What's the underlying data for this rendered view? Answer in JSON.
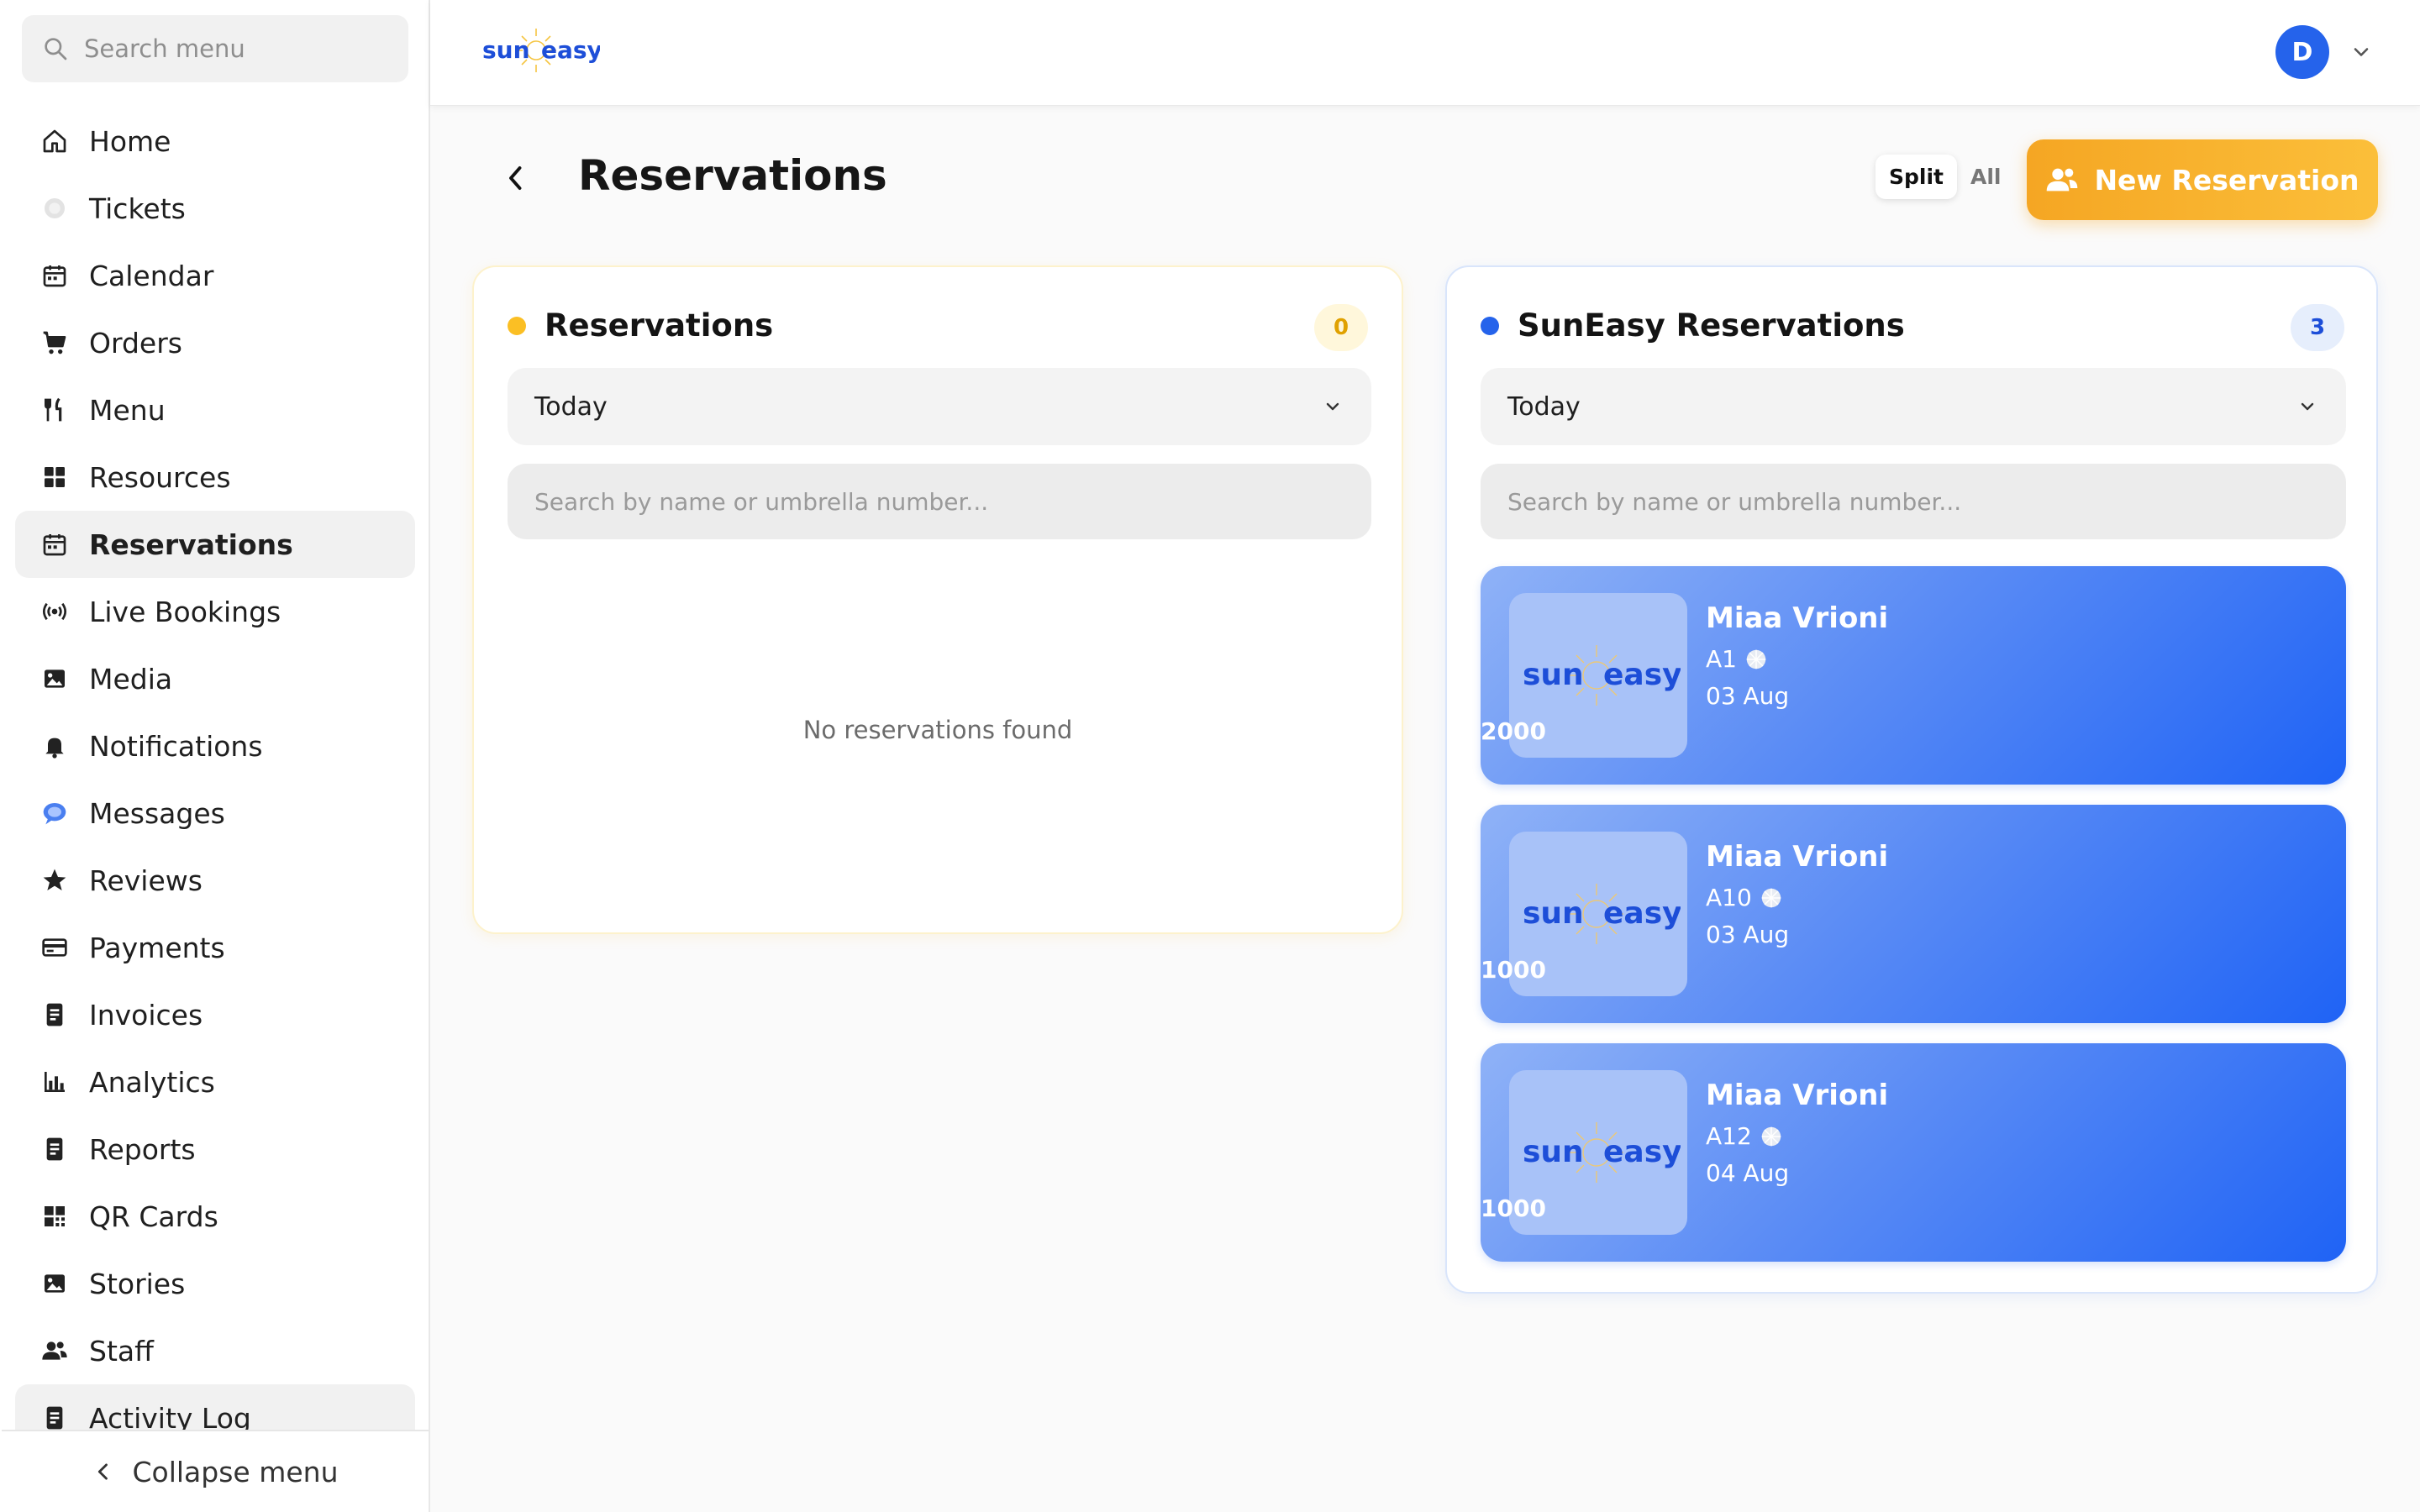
{
  "sidebar": {
    "search_placeholder": "Search menu",
    "items": [
      {
        "label": "Home",
        "icon": "home-icon"
      },
      {
        "label": "Tickets",
        "icon": "ticket-icon"
      },
      {
        "label": "Calendar",
        "icon": "calendar-icon"
      },
      {
        "label": "Orders",
        "icon": "cart-icon"
      },
      {
        "label": "Menu",
        "icon": "utensils-icon"
      },
      {
        "label": "Resources",
        "icon": "grid-icon"
      },
      {
        "label": "Reservations",
        "icon": "calendar-icon"
      },
      {
        "label": "Live Bookings",
        "icon": "broadcast-icon"
      },
      {
        "label": "Media",
        "icon": "image-icon"
      },
      {
        "label": "Notifications",
        "icon": "bell-icon"
      },
      {
        "label": "Messages",
        "icon": "chat-icon"
      },
      {
        "label": "Reviews",
        "icon": "star-icon"
      },
      {
        "label": "Payments",
        "icon": "credit-card-icon"
      },
      {
        "label": "Invoices",
        "icon": "document-icon"
      },
      {
        "label": "Analytics",
        "icon": "bar-chart-icon"
      },
      {
        "label": "Reports",
        "icon": "document-icon"
      },
      {
        "label": "QR Cards",
        "icon": "qr-icon"
      },
      {
        "label": "Stories",
        "icon": "image-icon"
      },
      {
        "label": "Staff",
        "icon": "users-icon"
      },
      {
        "label": "Activity Log",
        "icon": "document-icon"
      }
    ],
    "active": "Reservations",
    "collapse_label": "Collapse menu"
  },
  "header": {
    "logo": {
      "word1": "sun",
      "word2": "easy"
    },
    "avatar_initial": "D"
  },
  "page": {
    "title": "Reservations",
    "view_toggle": {
      "split": "Split",
      "all": "All",
      "selected": "Split"
    },
    "new_button": "New Reservation"
  },
  "left_panel": {
    "title": "Reservations",
    "count": "0",
    "filter": "Today",
    "search_placeholder": "Search by name or umbrella number...",
    "empty_text": "No reservations found",
    "accent": "#fbbf24"
  },
  "right_panel": {
    "title": "SunEasy Reservations",
    "count": "3",
    "filter": "Today",
    "search_placeholder": "Search by name or umbrella number...",
    "accent": "#2563eb",
    "reservations": [
      {
        "name": "Miaa Vrioni",
        "umbrella": "A1",
        "date": "03 Aug",
        "amount": "2000"
      },
      {
        "name": "Miaa Vrioni",
        "umbrella": "A10",
        "date": "03 Aug",
        "amount": "1000"
      },
      {
        "name": "Miaa Vrioni",
        "umbrella": "A12",
        "date": "04 Aug",
        "amount": "1000"
      }
    ]
  },
  "colors": {
    "brand_orange": "#f5a623",
    "brand_blue": "#2563eb"
  }
}
